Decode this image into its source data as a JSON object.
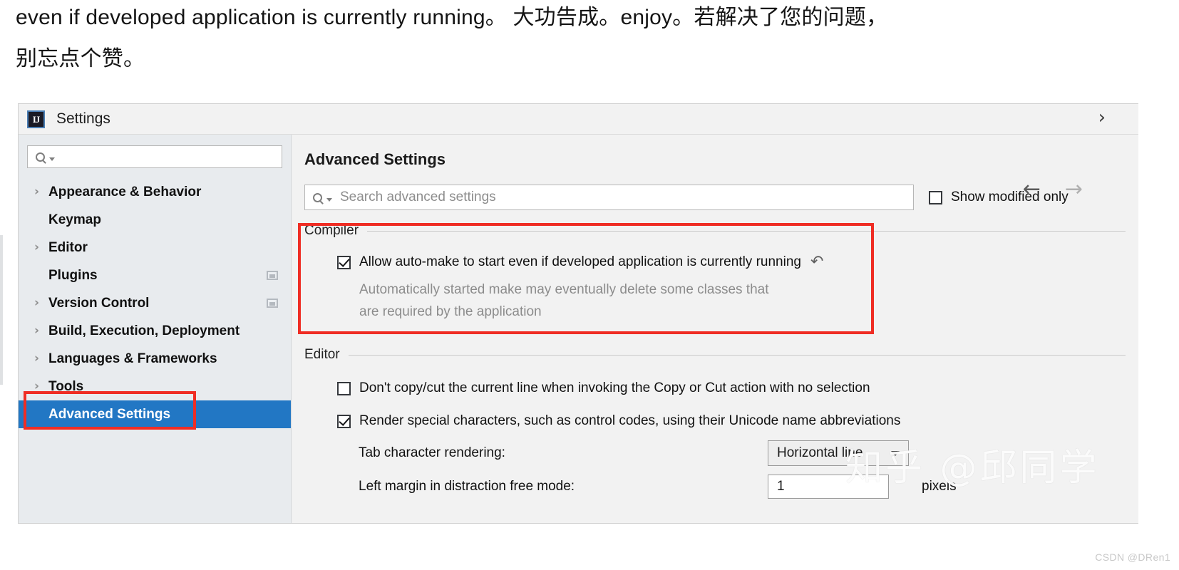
{
  "article": {
    "line1": "even if developed application is currently running。 大功告成。enjoy。若解决了您的问题，",
    "line2": "别忘点个赞。"
  },
  "dialog": {
    "app_icon_text": "IJ",
    "title": "Settings",
    "close_icon": "›"
  },
  "sidebar": {
    "search": {
      "placeholder": "",
      "value": ""
    },
    "items": [
      {
        "label": "Appearance & Behavior",
        "chevron": "›",
        "expandable": true,
        "trailing_icon": false,
        "selected": false
      },
      {
        "label": "Keymap",
        "chevron": "›",
        "expandable": false,
        "trailing_icon": false,
        "selected": false
      },
      {
        "label": "Editor",
        "chevron": "›",
        "expandable": true,
        "trailing_icon": false,
        "selected": false
      },
      {
        "label": "Plugins",
        "chevron": "›",
        "expandable": false,
        "trailing_icon": true,
        "selected": false
      },
      {
        "label": "Version Control",
        "chevron": "›",
        "expandable": true,
        "trailing_icon": true,
        "selected": false
      },
      {
        "label": "Build, Execution, Deployment",
        "chevron": "›",
        "expandable": true,
        "trailing_icon": false,
        "selected": false
      },
      {
        "label": "Languages & Frameworks",
        "chevron": "›",
        "expandable": true,
        "trailing_icon": false,
        "selected": false
      },
      {
        "label": "Tools",
        "chevron": "›",
        "expandable": true,
        "trailing_icon": false,
        "selected": false
      },
      {
        "label": "Advanced Settings",
        "chevron": "›",
        "expandable": false,
        "trailing_icon": false,
        "selected": true
      }
    ]
  },
  "content": {
    "title": "Advanced Settings",
    "nav": {
      "back_icon": "←",
      "forward_icon": "→"
    },
    "search": {
      "placeholder": "Search advanced settings",
      "value": ""
    },
    "show_modified_only": {
      "label": "Show modified only",
      "checked": false
    },
    "groups": [
      {
        "title": "Compiler",
        "options": [
          {
            "type": "checkbox",
            "label": "Allow auto-make to start even if developed application is currently running",
            "checked": true,
            "revert_icon": "↶",
            "description_line1": "Automatically started make may eventually delete some classes that",
            "description_line2": "are required by the application"
          }
        ]
      },
      {
        "title": "Editor",
        "options": [
          {
            "type": "checkbox",
            "label": "Don't copy/cut the current line when invoking the Copy or Cut action with no selection",
            "checked": false
          },
          {
            "type": "checkbox",
            "label": "Render special characters, such as control codes, using their Unicode name abbreviations",
            "checked": true
          },
          {
            "type": "combo",
            "label": "Tab character rendering:",
            "value": "Horizontal line"
          },
          {
            "type": "spinner",
            "label": "Left margin in distraction free mode:",
            "value": "1",
            "suffix": "pixels"
          }
        ]
      }
    ]
  },
  "watermarks": {
    "zhihu": "知乎 @邱同学",
    "csdn": "CSDN @DRen1"
  },
  "colors": {
    "selection_blue": "#2277c4",
    "annotation_red": "#ef2d24",
    "panel_bg": "#f2f2f2",
    "sidebar_bg": "#e8ebee"
  }
}
